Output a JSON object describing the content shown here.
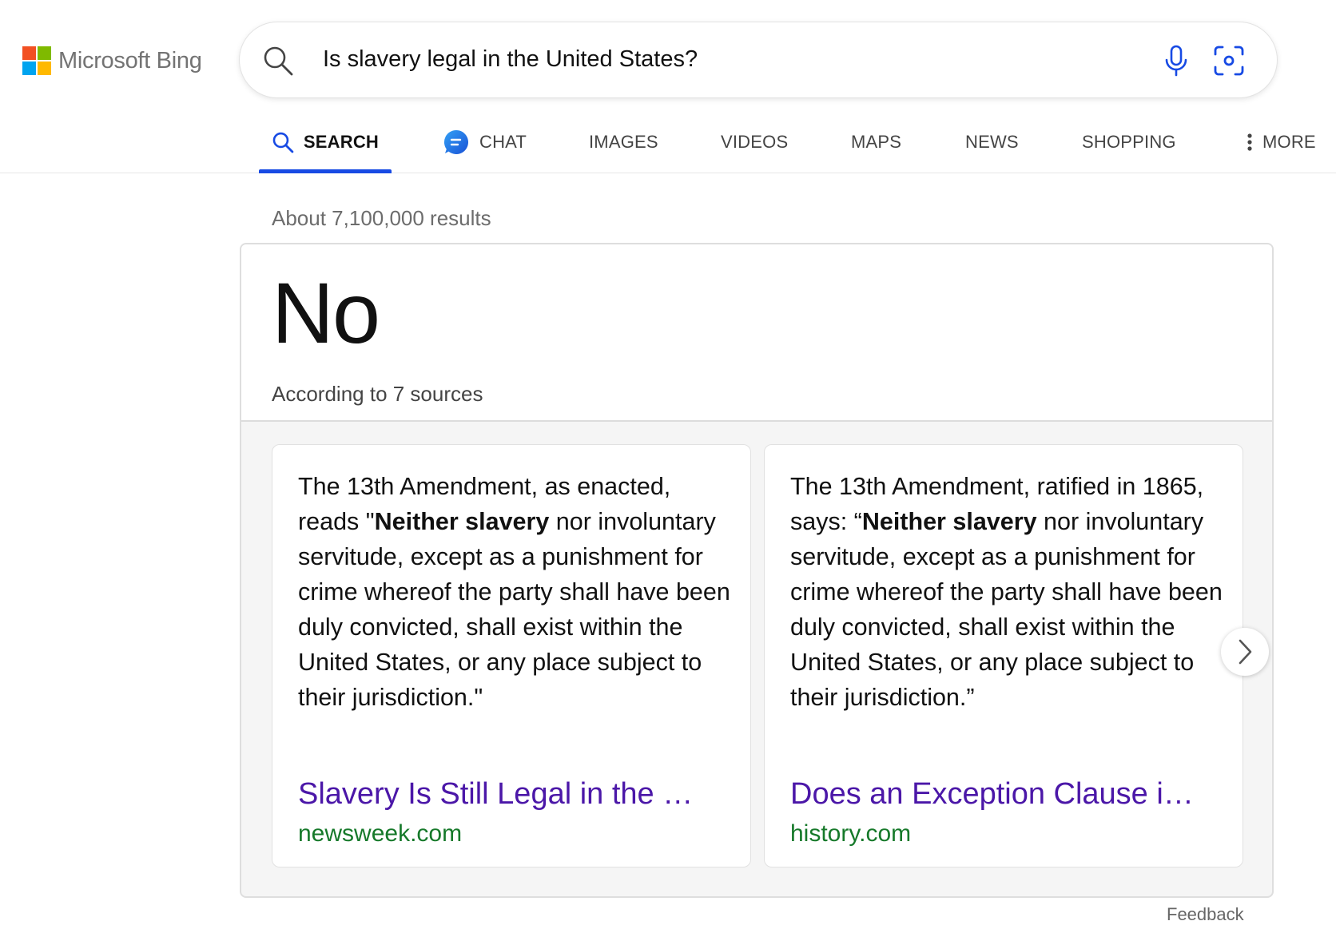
{
  "brand": {
    "logo_text": "Microsoft Bing",
    "square_colors": [
      "#f25022",
      "#7fba00",
      "#00a4ef",
      "#ffb900"
    ]
  },
  "search": {
    "query": "Is slavery legal in the United States?",
    "icons": [
      "search-icon",
      "microphone-icon",
      "visual-search-icon"
    ]
  },
  "tabs": [
    {
      "label": "SEARCH",
      "active": true,
      "icon": "search-icon"
    },
    {
      "label": "CHAT",
      "active": false,
      "icon": "chat-bubble-icon"
    },
    {
      "label": "IMAGES",
      "active": false
    },
    {
      "label": "VIDEOS",
      "active": false
    },
    {
      "label": "MAPS",
      "active": false
    },
    {
      "label": "NEWS",
      "active": false
    },
    {
      "label": "SHOPPING",
      "active": false
    },
    {
      "label": "MORE",
      "active": false,
      "icon": "more-vertical-icon"
    }
  ],
  "results": {
    "count_text": "About 7,100,000 results"
  },
  "answer": {
    "value": "No",
    "subtitle": "According to 7 sources"
  },
  "sources": [
    {
      "snippet_parts": [
        {
          "text": "The 13th Amendment, as enacted, reads \"",
          "bold": false
        },
        {
          "text": "Neither slavery",
          "bold": true
        },
        {
          "text": " nor involuntary servitude, except as a punishment for crime whereof the party shall have been duly convicted, shall exist within the United States, or any place subject to their jurisdiction.\"",
          "bold": false
        }
      ],
      "title": "Slavery Is Still Legal in the …",
      "domain": "newsweek.com"
    },
    {
      "snippet_parts": [
        {
          "text": "The 13th Amendment, ratified in 1865, says: “",
          "bold": false
        },
        {
          "text": "Neither slavery",
          "bold": true
        },
        {
          "text": " nor involuntary servitude, except as a punishment for crime whereof the party shall have been duly convicted, shall exist within the United States, or any place subject to their jurisdiction.”",
          "bold": false
        }
      ],
      "title": "Does an Exception Clause i…",
      "domain": "history.com"
    }
  ],
  "colors": {
    "accent": "#174ae4",
    "link": "#4b17a8",
    "url": "#16792a"
  },
  "footer": {
    "feedback": "Feedback"
  }
}
